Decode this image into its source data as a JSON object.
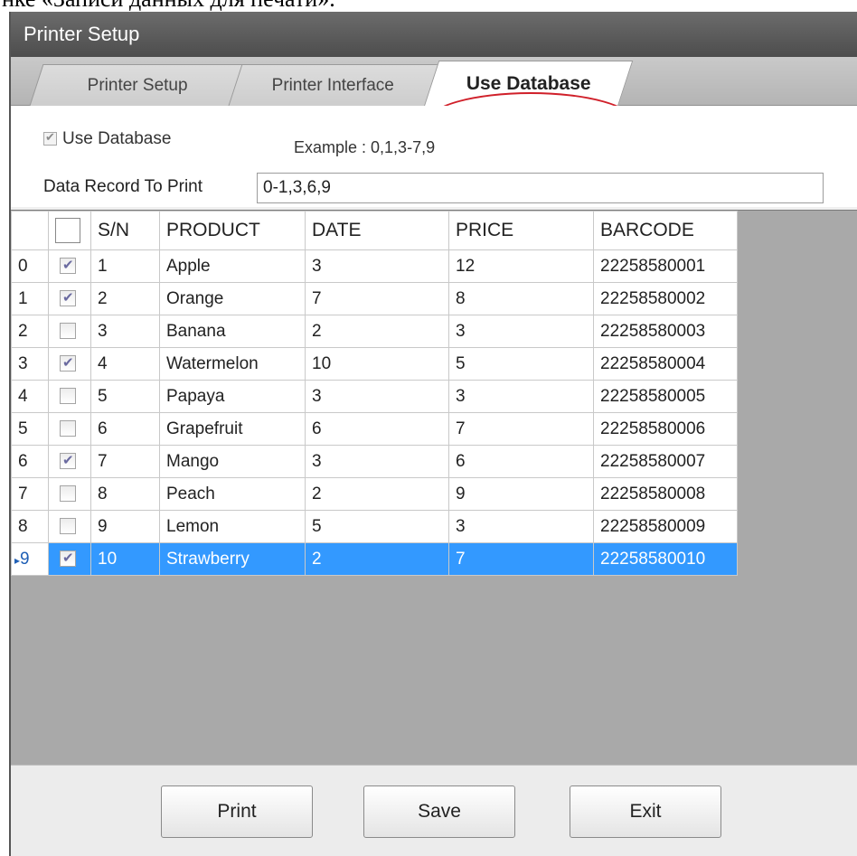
{
  "document": {
    "caption": "нке «Записи данных для печати»."
  },
  "window": {
    "title": "Printer Setup"
  },
  "tabs": [
    {
      "label": "Printer Setup",
      "active": false
    },
    {
      "label": "Printer Interface",
      "active": false
    },
    {
      "label": "Use Database",
      "active": true
    }
  ],
  "panel": {
    "use_database_label": "Use Database",
    "use_database_checked": true,
    "example_text": "Example : 0,1,3-7,9",
    "record_label": "Data Record To Print",
    "record_value": "0-1,3,6,9"
  },
  "grid": {
    "columns": [
      "S/N",
      "PRODUCT",
      "DATE",
      "PRICE",
      "BARCODE"
    ],
    "header_checked": false,
    "current_row_marker": "▸",
    "rows": [
      {
        "index": "0",
        "checked": true,
        "sn": "1",
        "product": "Apple",
        "date": "3",
        "price": "12",
        "barcode": "22258580001"
      },
      {
        "index": "1",
        "checked": true,
        "sn": "2",
        "product": "Orange",
        "date": "7",
        "price": "8",
        "barcode": "22258580002"
      },
      {
        "index": "2",
        "checked": false,
        "sn": "3",
        "product": "Banana",
        "date": "2",
        "price": "3",
        "barcode": "22258580003"
      },
      {
        "index": "3",
        "checked": true,
        "sn": "4",
        "product": "Watermelon",
        "date": "10",
        "price": "5",
        "barcode": "22258580004"
      },
      {
        "index": "4",
        "checked": false,
        "sn": "5",
        "product": "Papaya",
        "date": "3",
        "price": "3",
        "barcode": "22258580005"
      },
      {
        "index": "5",
        "checked": false,
        "sn": "6",
        "product": "Grapefruit",
        "date": "6",
        "price": "7",
        "barcode": "22258580006"
      },
      {
        "index": "6",
        "checked": true,
        "sn": "7",
        "product": "Mango",
        "date": "3",
        "price": "6",
        "barcode": "22258580007"
      },
      {
        "index": "7",
        "checked": false,
        "sn": "8",
        "product": "Peach",
        "date": "2",
        "price": "9",
        "barcode": "22258580008"
      },
      {
        "index": "8",
        "checked": false,
        "sn": "9",
        "product": "Lemon",
        "date": "5",
        "price": "3",
        "barcode": "22258580009"
      },
      {
        "index": "9",
        "checked": true,
        "sn": "10",
        "product": "Strawberry",
        "date": "2",
        "price": "7",
        "barcode": "22258580010",
        "selected": true
      }
    ]
  },
  "buttons": {
    "print": "Print",
    "save": "Save",
    "exit": "Exit"
  },
  "colors": {
    "selection": "#3399ff",
    "row_index": "#1f5fb5",
    "highlight_ellipse": "#d0202a",
    "titlebar": "#5a5a5a"
  }
}
